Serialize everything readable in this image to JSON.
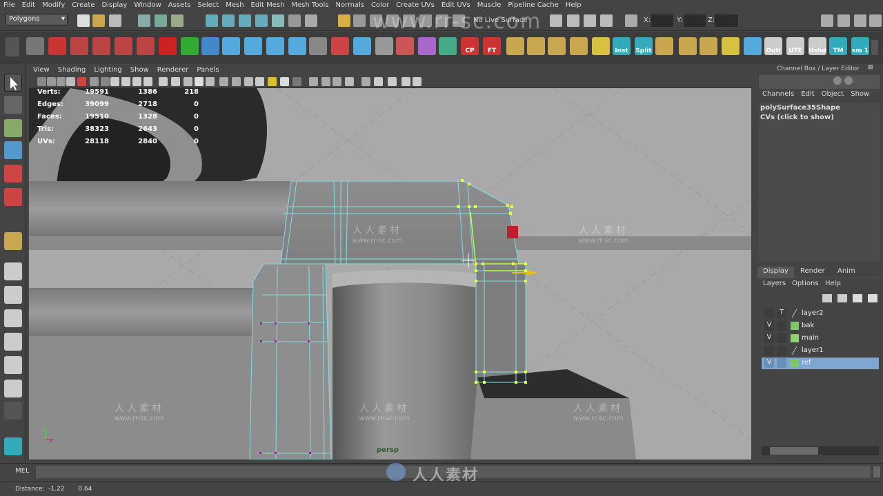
{
  "menubar": {
    "items": [
      "File",
      "Edit",
      "Modify",
      "Create",
      "Display",
      "Window",
      "Assets",
      "Select",
      "Mesh",
      "Edit Mesh",
      "Mesh Tools",
      "Normals",
      "Color",
      "Create UVs",
      "Edit UVs",
      "Muscle",
      "Pipeline Cache",
      "Help"
    ]
  },
  "statusline": {
    "mode": "Polygons",
    "live_surface": "No Live Surface",
    "x_label": "X:",
    "y_label": "Y:",
    "z_label": "Z:"
  },
  "shelf": {
    "labels": [
      "CP",
      "FT",
      "Inst",
      "Split",
      "Outl",
      "UTE",
      "Hshd",
      "TM",
      "sm 1"
    ]
  },
  "panel": {
    "menu": [
      "View",
      "Shading",
      "Lighting",
      "Show",
      "Renderer",
      "Panels"
    ],
    "camera": "persp"
  },
  "hud": {
    "rows": [
      {
        "label": "Verts:",
        "a": "19591",
        "b": "1386",
        "c": "218"
      },
      {
        "label": "Edges:",
        "a": "39099",
        "b": "2718",
        "c": "0"
      },
      {
        "label": "Faces:",
        "a": "19510",
        "b": "1328",
        "c": "0"
      },
      {
        "label": "Tris:",
        "a": "38323",
        "b": "2643",
        "c": "0"
      },
      {
        "label": "UVs:",
        "a": "28118",
        "b": "2840",
        "c": "0"
      }
    ]
  },
  "channelbox": {
    "title": "Channel Box / Layer Editor",
    "menu": [
      "Channels",
      "Edit",
      "Object",
      "Show"
    ],
    "object_name": "polySurface35Shape",
    "cvs": "CVs (click to show)"
  },
  "layereditor": {
    "tabs": [
      "Display",
      "Render",
      "Anim"
    ],
    "menu": [
      "Layers",
      "Options",
      "Help"
    ],
    "layers": [
      {
        "vis": "",
        "type": "T",
        "name": "layer2",
        "color": "",
        "selected": false
      },
      {
        "vis": "V",
        "type": "",
        "name": "bak",
        "color": "#7fc86a",
        "selected": false
      },
      {
        "vis": "V",
        "type": "",
        "name": "main",
        "color": "#8fd070",
        "selected": false
      },
      {
        "vis": "",
        "type": "",
        "name": "layer1",
        "color": "",
        "selected": false
      },
      {
        "vis": "V",
        "type": "",
        "name": "ref",
        "color": "#7fc86a",
        "selected": true
      }
    ]
  },
  "mel": {
    "label": "MEL"
  },
  "helpline": {
    "text": "Distance:  -1.22       0.64"
  },
  "watermark": {
    "cn": "人人素材",
    "url": "www.rr-sc.com",
    "brand": "人人素材",
    "top_url": "www.rr-sc.com"
  }
}
